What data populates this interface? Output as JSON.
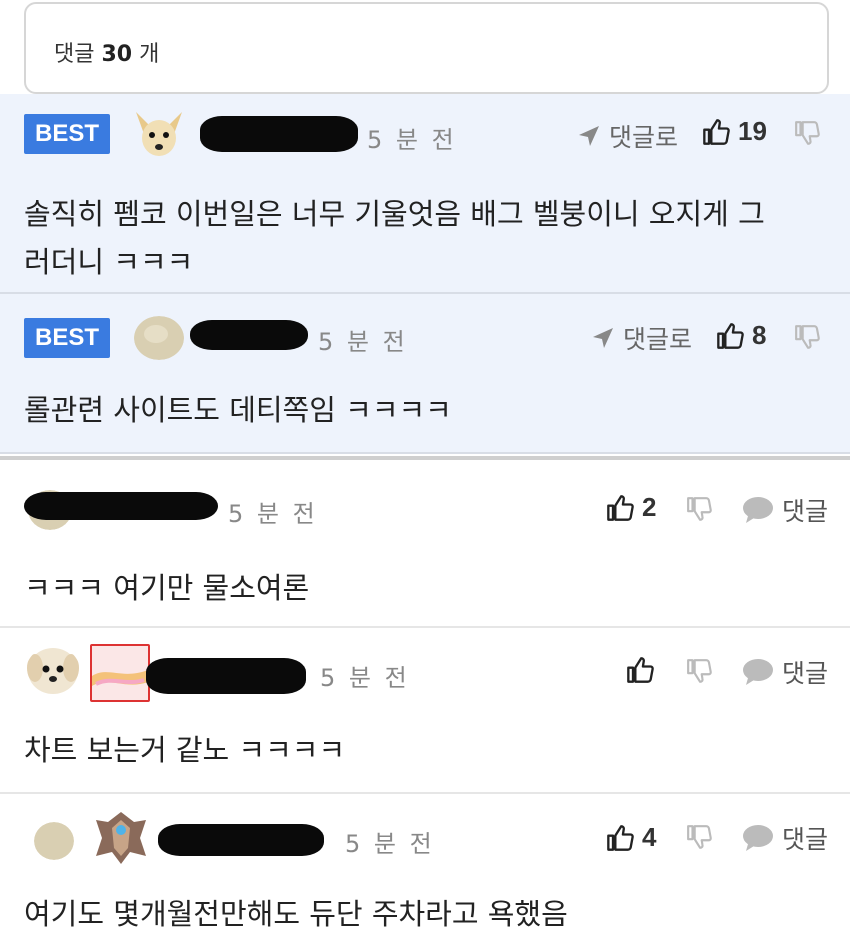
{
  "header": {
    "count_prefix": "댓글",
    "count_value": "30",
    "count_suffix": "개"
  },
  "best_label": "BEST",
  "reply_link_label": "댓글로",
  "reply_label": "댓글",
  "comments": [
    {
      "time": "5 분 전",
      "likes": "19",
      "text_line1": "솔직히 펨코 이번일은 너무 기울엇음 배그 벨붕이니 오지게 그",
      "text_line2": "러더니 ㅋㅋㅋ"
    },
    {
      "time": "5 분 전",
      "likes": "8",
      "text": "롤관련 사이트도 데티쪽임 ㅋㅋㅋㅋ"
    },
    {
      "time": "5 분 전",
      "likes": "2",
      "text": "ㅋㅋㅋ 여기만 물소여론"
    },
    {
      "time": "5 분 전",
      "likes": "",
      "text": "차트 보는거 같노 ㅋㅋㅋㅋ"
    },
    {
      "time": "5 분 전",
      "likes": "4",
      "text": "여기도 몇개월전만해도 듀단 주차라고 욕했음"
    }
  ]
}
